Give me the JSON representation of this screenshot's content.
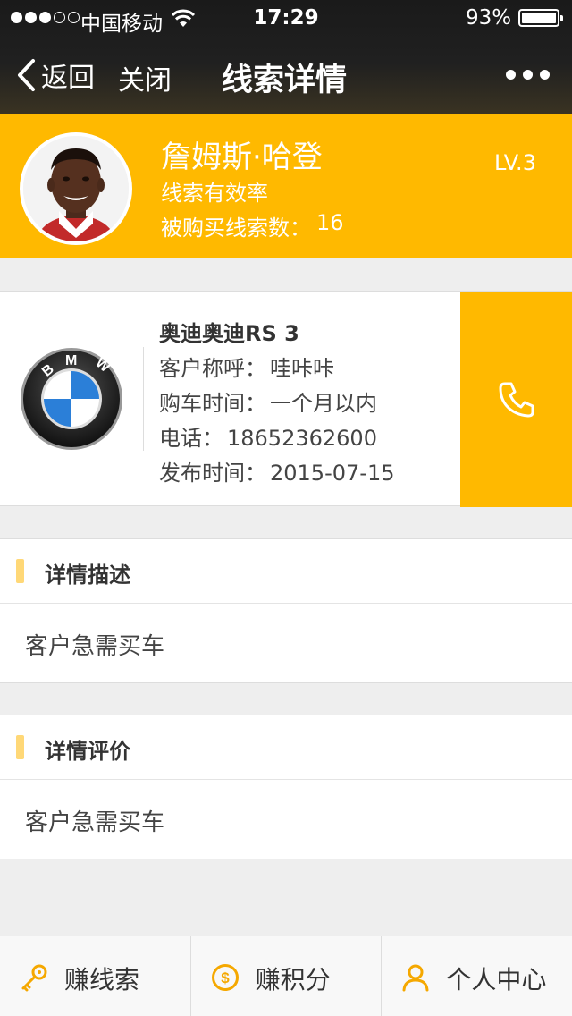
{
  "status_bar": {
    "carrier": "中国移动",
    "time": "17:29",
    "battery": "93%",
    "battery_level": 0.93,
    "signal_bars": 3
  },
  "nav": {
    "back_label": "返回",
    "close_label": "关闭",
    "title": "线索详情",
    "more_icon": "more-dots-icon"
  },
  "profile": {
    "name": "詹姆斯·哈登",
    "rate_label": "线索有效率",
    "bought_label": "被购买线索数：",
    "bought_count": "16",
    "level": "LV.3",
    "accent_color": "#ffb900"
  },
  "lead": {
    "brand_logo": "BMW",
    "model": "奥迪奥迪RS 3",
    "customer_label": "客户称呼：",
    "customer_value": "哇咔咔",
    "purchase_time_label": "购车时间：",
    "purchase_time_value": "一个月以内",
    "phone_label": "电话：",
    "phone_value": "18652362600",
    "publish_label": "发布时间：",
    "publish_value": "2015-07-15",
    "call_icon": "phone-icon"
  },
  "sections": [
    {
      "title": "详情描述",
      "content": "客户急需买车"
    },
    {
      "title": "详情评价",
      "content": "客户急需买车"
    }
  ],
  "tabbar": [
    {
      "label": "赚线索",
      "icon": "key-icon"
    },
    {
      "label": "赚积分",
      "icon": "dollar-coin-icon"
    },
    {
      "label": "个人中心",
      "icon": "person-icon"
    }
  ]
}
